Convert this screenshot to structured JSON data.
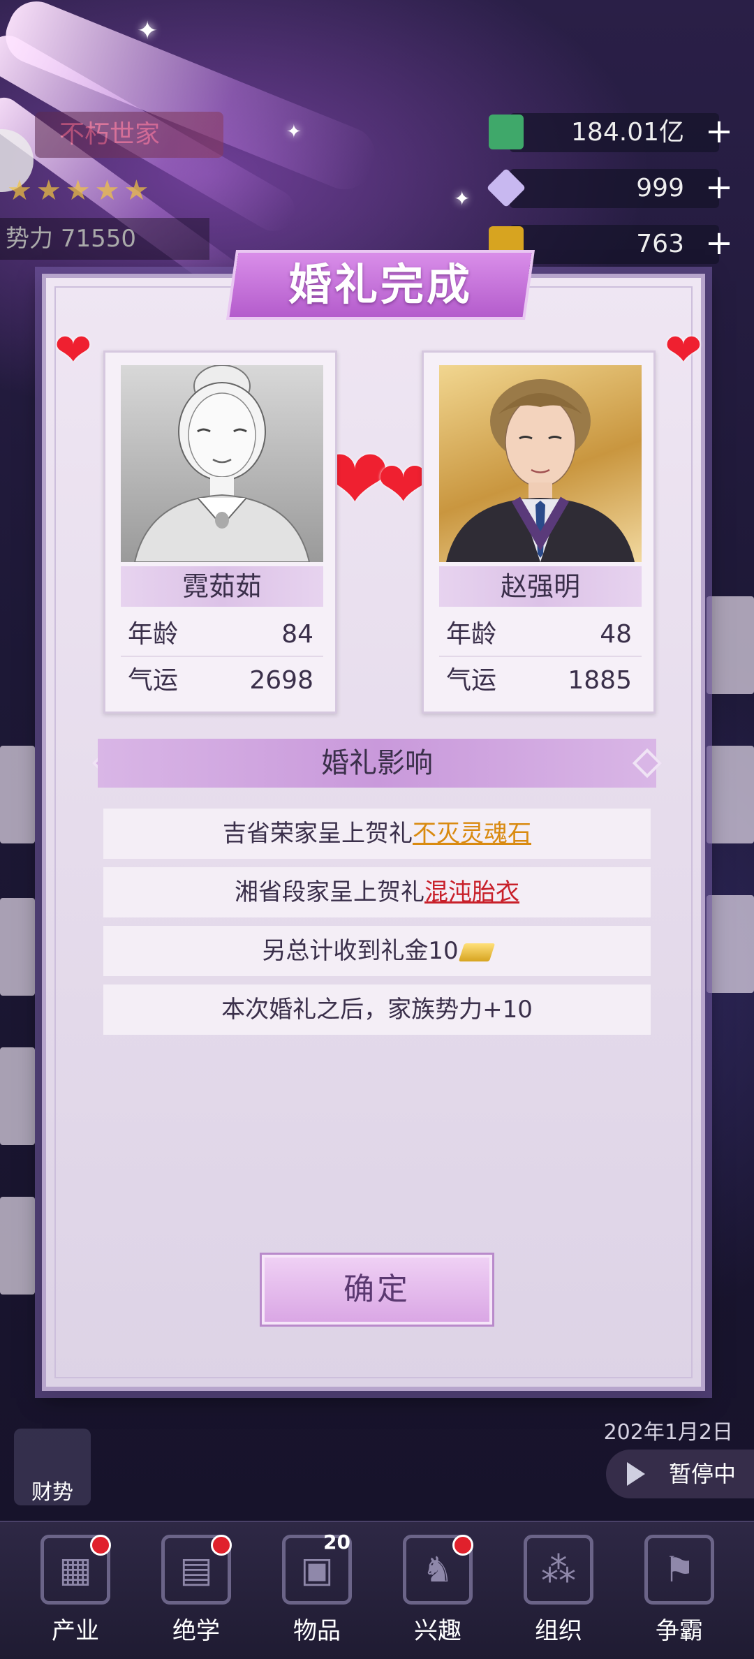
{
  "hud": {
    "family_name": "不朽世家",
    "power_label": "势力",
    "power_value": "71550",
    "resources": [
      {
        "icon": "cash-icon",
        "value": "184.01亿"
      },
      {
        "icon": "diamond-icon",
        "value": "999"
      },
      {
        "icon": "gold-bar-icon",
        "value": "763"
      }
    ]
  },
  "dialog": {
    "title": "婚礼完成",
    "bride": {
      "name": "霓茹茹",
      "age_label": "年龄",
      "age": "84",
      "luck_label": "气运",
      "luck": "2698"
    },
    "groom": {
      "name": "赵强明",
      "age_label": "年龄",
      "age": "48",
      "luck_label": "气运",
      "luck": "1885"
    },
    "impact_title": "婚礼影响",
    "impacts": [
      {
        "text": "吉省荣家呈上贺礼",
        "gift": "不灭灵魂石"
      },
      {
        "text": "湘省段家呈上贺礼",
        "gift": "混沌胎衣"
      },
      {
        "text": "另总计收到礼金10"
      },
      {
        "text": "本次婚礼之后，家族势力+10"
      }
    ],
    "confirm_label": "确定"
  },
  "status": {
    "date": "202年1月2日",
    "pause_label": "暂停中",
    "wealth_label": "财势"
  },
  "nav": [
    {
      "label": "产业",
      "icon": "industry-icon"
    },
    {
      "label": "绝学",
      "icon": "skills-icon"
    },
    {
      "label": "物品",
      "icon": "items-icon",
      "count": "20"
    },
    {
      "label": "兴趣",
      "icon": "chess-knight-icon"
    },
    {
      "label": "组织",
      "icon": "organization-icon"
    },
    {
      "label": "争霸",
      "icon": "hegemony-icon"
    }
  ]
}
